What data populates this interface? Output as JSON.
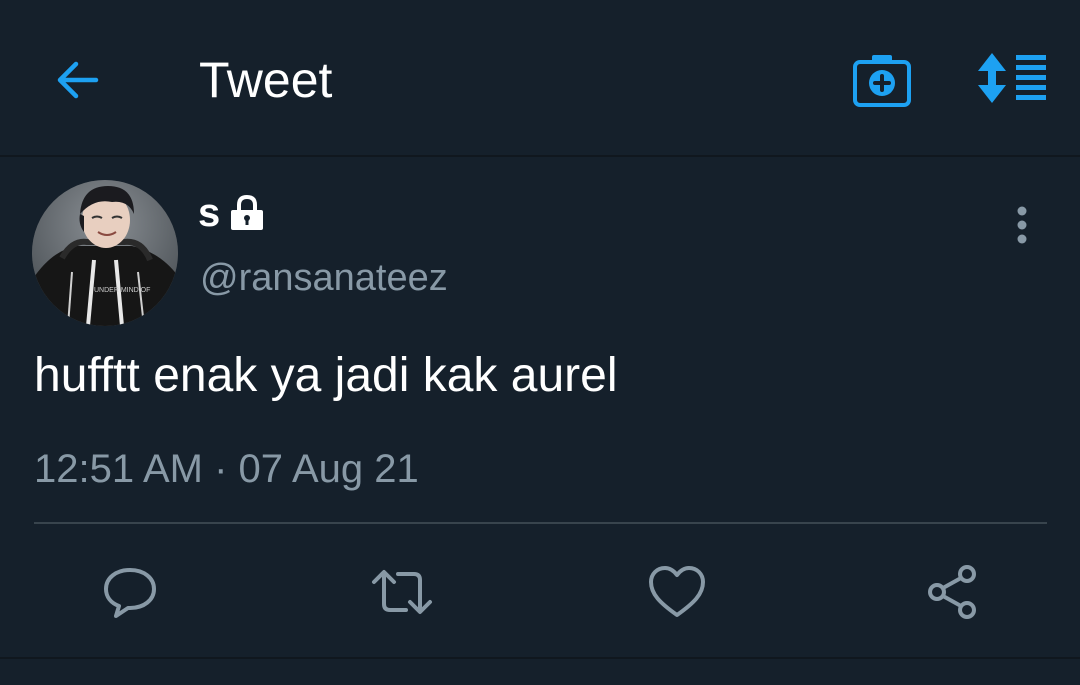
{
  "header": {
    "title": "Tweet",
    "back_icon": "arrow-left-icon",
    "camera_icon": "camera-plus-icon",
    "sort_icon": "sort-list-icon"
  },
  "tweet": {
    "display_name": "s",
    "protected_icon": "lock-icon",
    "handle": "@ransanateez",
    "text": "hufftt enak ya jadi kak aurel",
    "timestamp": "12:51 AM · 07 Aug 21",
    "more_icon": "more-vertical-icon",
    "avatar_shirt_text": "UNDER MIND OF"
  },
  "actions": {
    "reply_icon": "reply-icon",
    "retweet_icon": "retweet-icon",
    "like_icon": "heart-icon",
    "share_icon": "share-icon"
  },
  "colors": {
    "background": "#15202b",
    "accent": "#1da1f2",
    "secondary_text": "#8899a6",
    "divider": "#38444d"
  }
}
